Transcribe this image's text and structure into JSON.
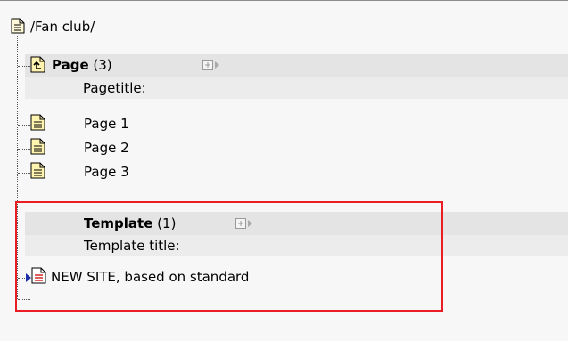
{
  "root": {
    "path": "/Fan club/",
    "icon": "page-icon"
  },
  "tables": [
    {
      "name": "Page",
      "count": "(3)",
      "field_label": "Pagetitle:",
      "icon": "page-up-icon",
      "records": [
        {
          "title": "Page 1",
          "icon": "page-icon"
        },
        {
          "title": "Page 2",
          "icon": "page-icon"
        },
        {
          "title": "Page 3",
          "icon": "page-icon"
        }
      ]
    },
    {
      "name": "Template",
      "count": "(1)",
      "field_label": "Template title:",
      "records": [
        {
          "title": "NEW SITE, based on standard",
          "icon": "template-record-icon"
        }
      ]
    }
  ],
  "colors": {
    "highlight_border": "#ec1c24",
    "band": "#e4e4e4"
  }
}
